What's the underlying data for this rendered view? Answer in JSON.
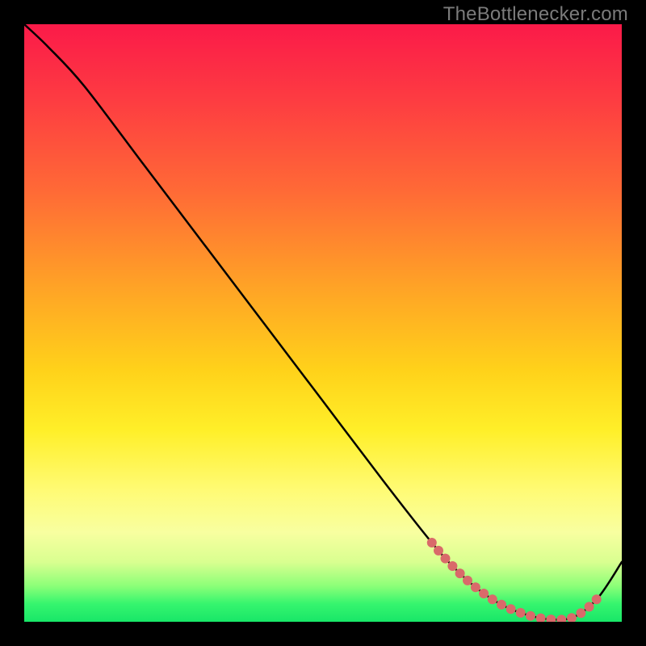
{
  "watermark": "TheBottlenecker.com",
  "chart_data": {
    "type": "line",
    "title": "",
    "xlabel": "",
    "ylabel": "",
    "xlim": [
      0,
      100
    ],
    "ylim": [
      0,
      100
    ],
    "x": [
      0,
      4,
      10,
      20,
      30,
      40,
      50,
      60,
      68,
      72,
      76,
      80,
      84,
      88,
      92,
      96,
      100
    ],
    "values": [
      100,
      96.2,
      89.7,
      76.5,
      63.3,
      50.1,
      36.9,
      23.7,
      13.5,
      9.0,
      5.4,
      2.8,
      1.2,
      0.4,
      0.8,
      4.0,
      10.0
    ],
    "highlight_region": {
      "x_start": 68,
      "x_end": 96
    },
    "background_gradient": {
      "direction": "vertical",
      "stops": [
        {
          "pos": 0.0,
          "color": "#fb1a49"
        },
        {
          "pos": 0.28,
          "color": "#ff6a36"
        },
        {
          "pos": 0.58,
          "color": "#ffd21a"
        },
        {
          "pos": 0.85,
          "color": "#f8ffa0"
        },
        {
          "pos": 0.97,
          "color": "#36f56e"
        },
        {
          "pos": 1.0,
          "color": "#18e668"
        }
      ]
    },
    "highlight_dot_color": "#d96a6a",
    "curve_color": "#000000"
  }
}
